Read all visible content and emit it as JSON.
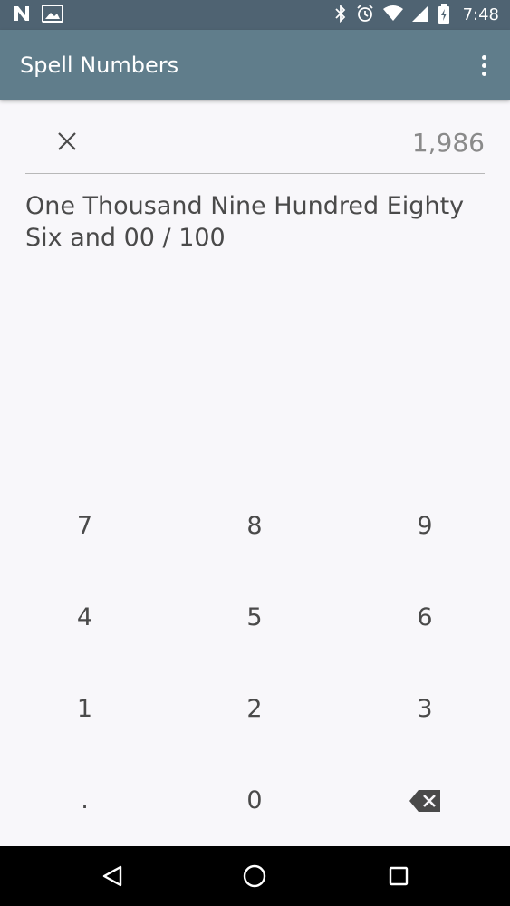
{
  "status_bar": {
    "time": "7:48",
    "left_icons": [
      "n-notification-icon",
      "image-notification-icon"
    ],
    "right_icons": [
      "bluetooth-icon",
      "alarm-icon",
      "wifi-icon",
      "signal-icon",
      "battery-charging-icon"
    ]
  },
  "app_bar": {
    "title": "Spell Numbers",
    "overflow_icon": "more-vert-icon"
  },
  "input": {
    "value": "1,986",
    "clear_icon": "close-icon"
  },
  "result": {
    "text": "One Thousand Nine Hundred Eighty Six and 00 / 100"
  },
  "keypad": {
    "keys": [
      "7",
      "8",
      "9",
      "4",
      "5",
      "6",
      "1",
      "2",
      "3",
      ".",
      "0"
    ],
    "backspace_icon": "backspace-icon"
  },
  "nav_bar": {
    "icons": [
      "back-icon",
      "home-icon",
      "recents-icon"
    ]
  },
  "colors": {
    "status_bar": "#4f6372",
    "app_bar": "#607d8b",
    "background": "#f8f7fa",
    "text": "#4a4a4a",
    "value_text": "#8a8a8a"
  }
}
